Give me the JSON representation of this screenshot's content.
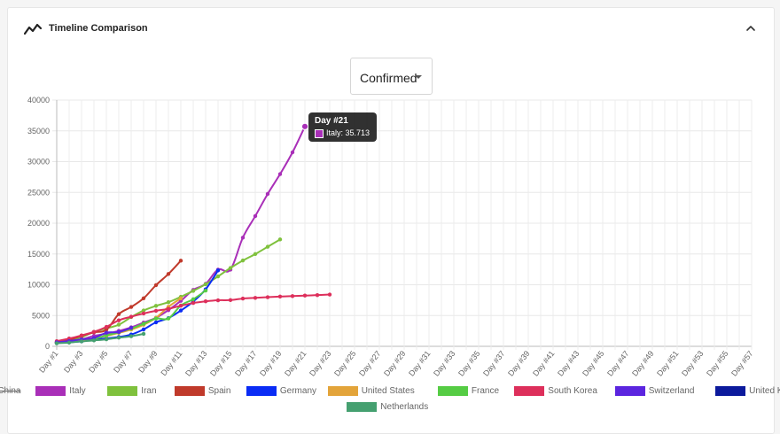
{
  "header": {
    "title": "Timeline Comparison",
    "title_icon": "line-chart-icon",
    "collapse_icon": "chevron-up-icon"
  },
  "metric_select": {
    "selected": "Confirmed"
  },
  "tooltip": {
    "title": "Day #21",
    "body": "Italy: 35.713",
    "color": "#a92fb8"
  },
  "legend": [
    {
      "name": "China",
      "color": "#6ee0d8",
      "hidden": true
    },
    {
      "name": "Italy",
      "color": "#a92fb8"
    },
    {
      "name": "Iran",
      "color": "#7fc13d"
    },
    {
      "name": "Spain",
      "color": "#c03a2b"
    },
    {
      "name": "Germany",
      "color": "#0a2cf5"
    },
    {
      "name": "United States",
      "color": "#e3a43a"
    },
    {
      "name": "France",
      "color": "#55cc44"
    },
    {
      "name": "South Korea",
      "color": "#dd2f5b"
    },
    {
      "name": "Switzerland",
      "color": "#5b25df"
    },
    {
      "name": "United Kingdom",
      "color": "#0c1a9c"
    },
    {
      "name": "Netherlands",
      "color": "#45a070"
    }
  ],
  "chart_data": {
    "type": "line",
    "x": [
      "Day #1",
      "Day #3",
      "Day #5",
      "Day #7",
      "Day #9",
      "Day #11",
      "Day #13",
      "Day #15",
      "Day #17",
      "Day #19",
      "Day #21",
      "Day #23",
      "Day #25",
      "Day #27",
      "Day #29",
      "Day #31",
      "Day #33",
      "Day #35",
      "Day #37",
      "Day #39",
      "Day #41",
      "Day #43",
      "Day #45",
      "Day #47",
      "Day #49",
      "Day #51",
      "Day #53",
      "Day #55",
      "Day #57"
    ],
    "x_days": [
      1,
      57
    ],
    "ylim": [
      0,
      40000
    ],
    "yticks": [
      "0",
      "5000",
      "10000",
      "15000",
      "20000",
      "25000",
      "30000",
      "35000",
      "40000"
    ],
    "series": [
      {
        "name": "Italy",
        "color": "#a92fb8",
        "values": [
          650,
          890,
          1130,
          1700,
          2040,
          2500,
          3090,
          3860,
          4640,
          5880,
          7380,
          9170,
          10150,
          12460,
          12460,
          17660,
          21160,
          24750,
          27980,
          31510,
          35713
        ]
      },
      {
        "name": "Iran",
        "color": "#7fc13d",
        "values": [
          590,
          980,
          1500,
          2340,
          2920,
          3510,
          4750,
          5820,
          6570,
          7160,
          8040,
          9000,
          10080,
          11360,
          12730,
          13940,
          14990,
          16170,
          17360
        ]
      },
      {
        "name": "Spain",
        "color": "#c03a2b",
        "values": [
          670,
          1070,
          1700,
          2270,
          2690,
          5230,
          6390,
          7800,
          9940,
          11750,
          13910
        ]
      },
      {
        "name": "Germany",
        "color": "#0a2cf5",
        "values": [
          530,
          670,
          800,
          1110,
          1300,
          1510,
          1910,
          2750,
          3900,
          4580,
          5810,
          7270,
          9260,
          12330
        ]
      },
      {
        "name": "United States",
        "color": "#e3a43a",
        "values": [
          560,
          660,
          950,
          1300,
          1700,
          2180,
          2720,
          3500,
          4630,
          6420,
          7780
        ]
      },
      {
        "name": "France",
        "color": "#55cc44",
        "values": [
          610,
          720,
          1130,
          1210,
          1780,
          2280,
          2880,
          3660,
          4500,
          4520,
          6630,
          7650,
          9050
        ]
      },
      {
        "name": "South Korea",
        "color": "#dd2f5b",
        "values": [
          830,
          1260,
          1770,
          2340,
          3150,
          4220,
          4810,
          5330,
          5770,
          6090,
          6590,
          7040,
          7310,
          7480,
          7510,
          7760,
          7870,
          7980,
          8090,
          8160,
          8240,
          8320,
          8410
        ]
      },
      {
        "name": "Switzerland",
        "color": "#5b25df",
        "values": [
          650,
          860,
          1130,
          1360,
          2200,
          2330,
          3010
        ]
      },
      {
        "name": "Netherlands",
        "color": "#45a070",
        "values": [
          500,
          600,
          800,
          960,
          1140,
          1410,
          1640,
          2020
        ]
      }
    ],
    "highlight": {
      "series": "Italy",
      "day": 21,
      "value": 35713
    }
  }
}
